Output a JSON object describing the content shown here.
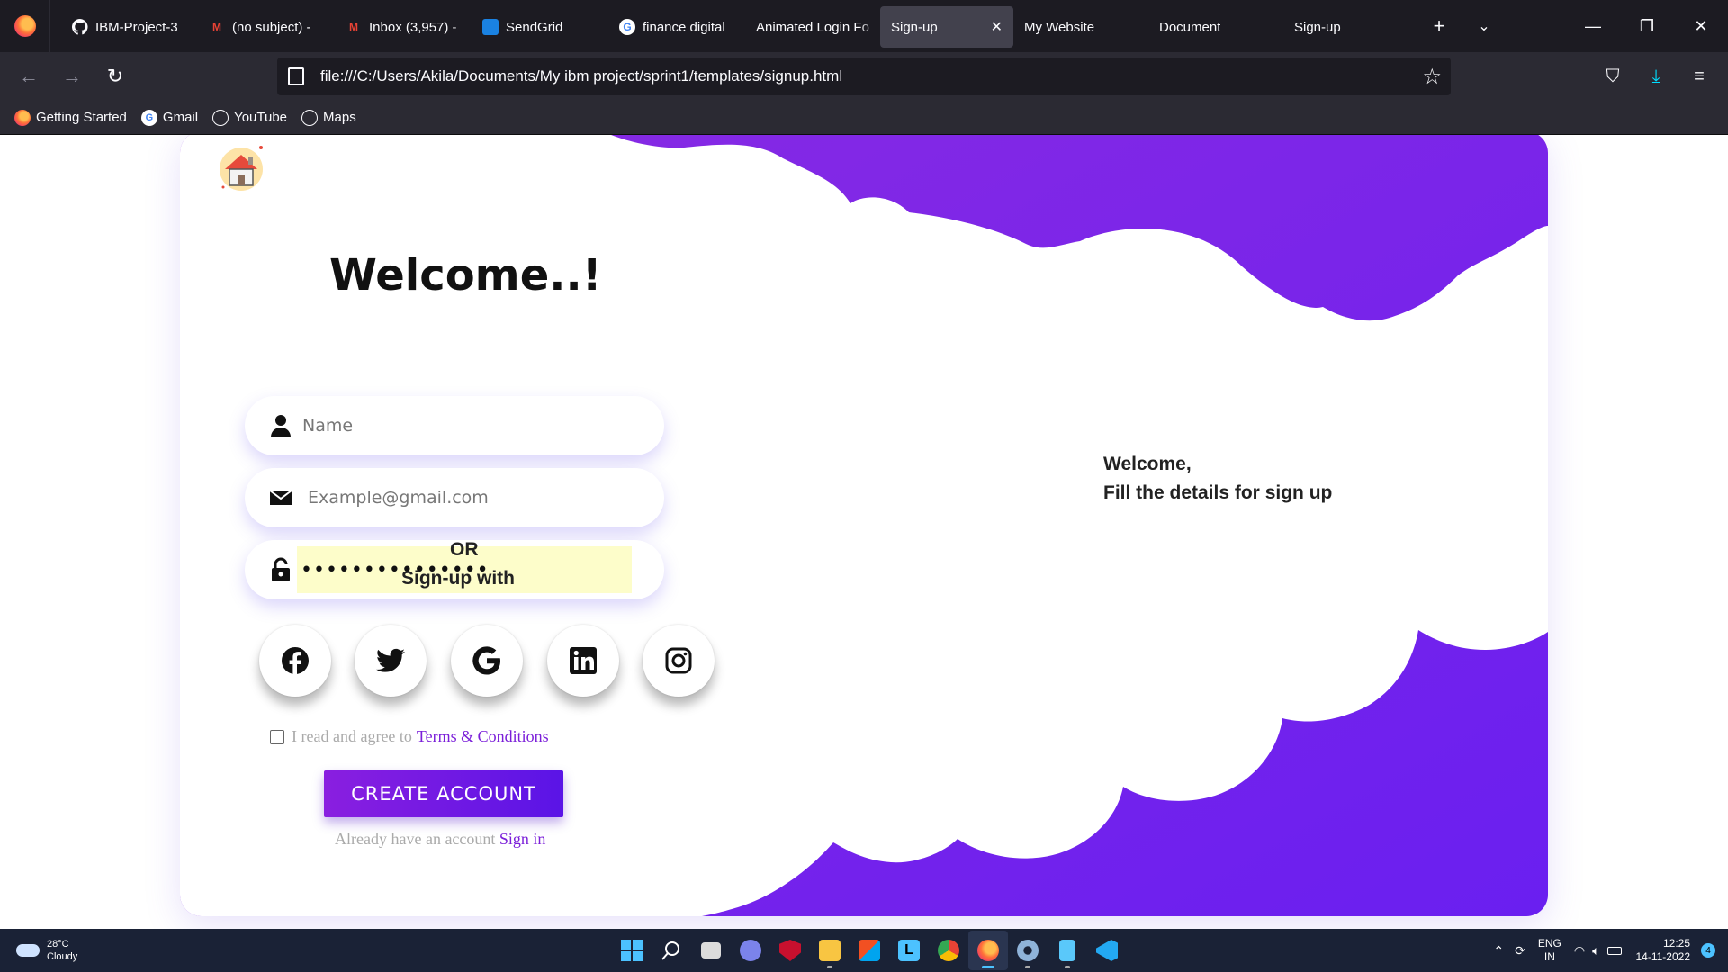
{
  "browser": {
    "tabs": [
      {
        "label": "IBM-Project-3",
        "icon": "github-icon",
        "active": false
      },
      {
        "label": "(no subject) -",
        "icon": "gmail-icon",
        "active": false
      },
      {
        "label": "Inbox (3,957) -",
        "icon": "gmail-icon",
        "active": false
      },
      {
        "label": "SendGrid",
        "icon": "sendgrid-icon",
        "active": false
      },
      {
        "label": "finance digital",
        "icon": "google-icon",
        "active": false
      },
      {
        "label": "Animated Login Fo",
        "icon": "",
        "active": false
      },
      {
        "label": "Sign-up",
        "icon": "",
        "active": true
      },
      {
        "label": "My Website",
        "icon": "",
        "active": false
      },
      {
        "label": "Document",
        "icon": "",
        "active": false
      },
      {
        "label": "Sign-up",
        "icon": "",
        "active": false
      }
    ],
    "url": "file:///C:/Users/Akila/Documents/My ibm project/sprint1/templates/signup.html",
    "bookmarks": [
      {
        "label": "Getting Started",
        "icon": "firefox-icon"
      },
      {
        "label": "Gmail",
        "icon": "google-icon"
      },
      {
        "label": "YouTube",
        "icon": "globe-icon"
      },
      {
        "label": "Maps",
        "icon": "globe-icon"
      }
    ]
  },
  "form": {
    "title": "Welcome..!",
    "name_placeholder": "Name",
    "email_placeholder": "Example@gmail.com",
    "password_value": "•••••••••••••••",
    "or_label": "OR",
    "signup_with_label": "Sign-up with",
    "social": [
      "facebook-icon",
      "twitter-icon",
      "google-icon",
      "linkedin-icon",
      "instagram-icon"
    ],
    "terms_prefix": "I read and agree to",
    "terms_link": "Terms & Conditions",
    "create_button": "CREATE ACCOUNT",
    "already_text": "Already have an account",
    "signin_link": "Sign in"
  },
  "side_panel": {
    "line1": "Welcome,",
    "line2": "Fill the details for sign up"
  },
  "colors": {
    "accent_purple": "#7b1fd9",
    "cloud_purple": "#7b2ff7",
    "button_start": "#8a1fe0",
    "button_end": "#5a14e6"
  },
  "taskbar": {
    "temperature": "28°C",
    "condition": "Cloudy",
    "lang_line1": "ENG",
    "lang_line2": "IN",
    "time": "12:25",
    "date": "14-11-2022",
    "notification_count": "4"
  }
}
